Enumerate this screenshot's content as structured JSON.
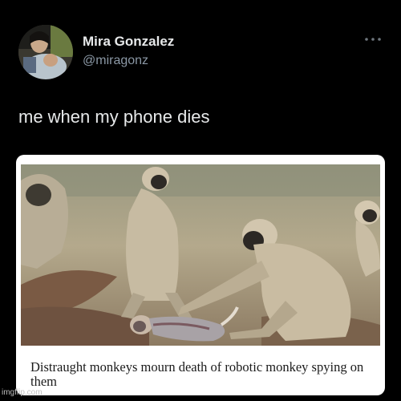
{
  "tweet": {
    "author_name": "Mira Gonzalez",
    "author_handle": "@miragonz",
    "text": "me when my phone dies",
    "more_icon": "more-horizontal-icon"
  },
  "media": {
    "caption": "Distraught monkeys mourn death of robotic monkey spying on them"
  },
  "watermark": "imgflip.com",
  "colors": {
    "background": "#000000",
    "primary_text": "#e7e9ea",
    "secondary_text": "#8b98a5",
    "card_background": "#ffffff"
  }
}
